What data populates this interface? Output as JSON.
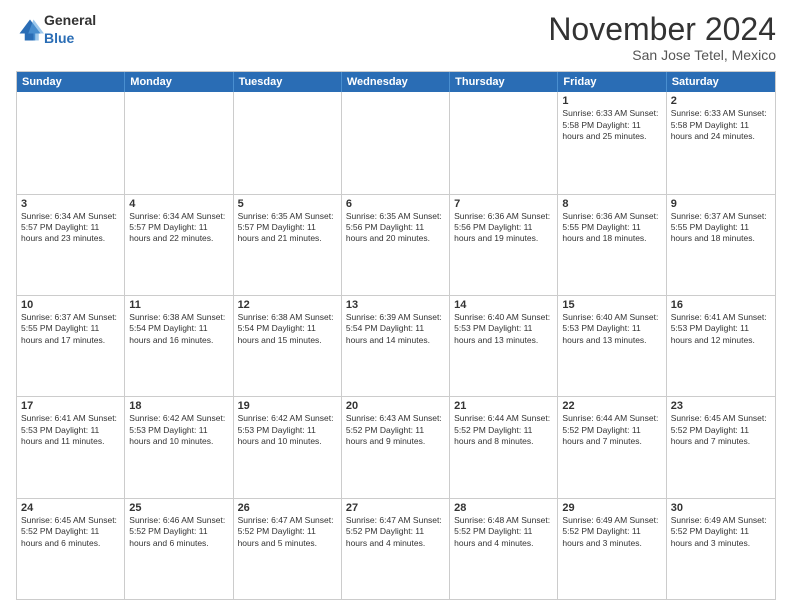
{
  "logo": {
    "general": "General",
    "blue": "Blue"
  },
  "header": {
    "title": "November 2024",
    "location": "San Jose Tetel, Mexico"
  },
  "weekdays": [
    "Sunday",
    "Monday",
    "Tuesday",
    "Wednesday",
    "Thursday",
    "Friday",
    "Saturday"
  ],
  "weeks": [
    [
      {
        "day": "",
        "info": ""
      },
      {
        "day": "",
        "info": ""
      },
      {
        "day": "",
        "info": ""
      },
      {
        "day": "",
        "info": ""
      },
      {
        "day": "",
        "info": ""
      },
      {
        "day": "1",
        "info": "Sunrise: 6:33 AM\nSunset: 5:58 PM\nDaylight: 11 hours and 25 minutes."
      },
      {
        "day": "2",
        "info": "Sunrise: 6:33 AM\nSunset: 5:58 PM\nDaylight: 11 hours and 24 minutes."
      }
    ],
    [
      {
        "day": "3",
        "info": "Sunrise: 6:34 AM\nSunset: 5:57 PM\nDaylight: 11 hours and 23 minutes."
      },
      {
        "day": "4",
        "info": "Sunrise: 6:34 AM\nSunset: 5:57 PM\nDaylight: 11 hours and 22 minutes."
      },
      {
        "day": "5",
        "info": "Sunrise: 6:35 AM\nSunset: 5:57 PM\nDaylight: 11 hours and 21 minutes."
      },
      {
        "day": "6",
        "info": "Sunrise: 6:35 AM\nSunset: 5:56 PM\nDaylight: 11 hours and 20 minutes."
      },
      {
        "day": "7",
        "info": "Sunrise: 6:36 AM\nSunset: 5:56 PM\nDaylight: 11 hours and 19 minutes."
      },
      {
        "day": "8",
        "info": "Sunrise: 6:36 AM\nSunset: 5:55 PM\nDaylight: 11 hours and 18 minutes."
      },
      {
        "day": "9",
        "info": "Sunrise: 6:37 AM\nSunset: 5:55 PM\nDaylight: 11 hours and 18 minutes."
      }
    ],
    [
      {
        "day": "10",
        "info": "Sunrise: 6:37 AM\nSunset: 5:55 PM\nDaylight: 11 hours and 17 minutes."
      },
      {
        "day": "11",
        "info": "Sunrise: 6:38 AM\nSunset: 5:54 PM\nDaylight: 11 hours and 16 minutes."
      },
      {
        "day": "12",
        "info": "Sunrise: 6:38 AM\nSunset: 5:54 PM\nDaylight: 11 hours and 15 minutes."
      },
      {
        "day": "13",
        "info": "Sunrise: 6:39 AM\nSunset: 5:54 PM\nDaylight: 11 hours and 14 minutes."
      },
      {
        "day": "14",
        "info": "Sunrise: 6:40 AM\nSunset: 5:53 PM\nDaylight: 11 hours and 13 minutes."
      },
      {
        "day": "15",
        "info": "Sunrise: 6:40 AM\nSunset: 5:53 PM\nDaylight: 11 hours and 13 minutes."
      },
      {
        "day": "16",
        "info": "Sunrise: 6:41 AM\nSunset: 5:53 PM\nDaylight: 11 hours and 12 minutes."
      }
    ],
    [
      {
        "day": "17",
        "info": "Sunrise: 6:41 AM\nSunset: 5:53 PM\nDaylight: 11 hours and 11 minutes."
      },
      {
        "day": "18",
        "info": "Sunrise: 6:42 AM\nSunset: 5:53 PM\nDaylight: 11 hours and 10 minutes."
      },
      {
        "day": "19",
        "info": "Sunrise: 6:42 AM\nSunset: 5:53 PM\nDaylight: 11 hours and 10 minutes."
      },
      {
        "day": "20",
        "info": "Sunrise: 6:43 AM\nSunset: 5:52 PM\nDaylight: 11 hours and 9 minutes."
      },
      {
        "day": "21",
        "info": "Sunrise: 6:44 AM\nSunset: 5:52 PM\nDaylight: 11 hours and 8 minutes."
      },
      {
        "day": "22",
        "info": "Sunrise: 6:44 AM\nSunset: 5:52 PM\nDaylight: 11 hours and 7 minutes."
      },
      {
        "day": "23",
        "info": "Sunrise: 6:45 AM\nSunset: 5:52 PM\nDaylight: 11 hours and 7 minutes."
      }
    ],
    [
      {
        "day": "24",
        "info": "Sunrise: 6:45 AM\nSunset: 5:52 PM\nDaylight: 11 hours and 6 minutes."
      },
      {
        "day": "25",
        "info": "Sunrise: 6:46 AM\nSunset: 5:52 PM\nDaylight: 11 hours and 6 minutes."
      },
      {
        "day": "26",
        "info": "Sunrise: 6:47 AM\nSunset: 5:52 PM\nDaylight: 11 hours and 5 minutes."
      },
      {
        "day": "27",
        "info": "Sunrise: 6:47 AM\nSunset: 5:52 PM\nDaylight: 11 hours and 4 minutes."
      },
      {
        "day": "28",
        "info": "Sunrise: 6:48 AM\nSunset: 5:52 PM\nDaylight: 11 hours and 4 minutes."
      },
      {
        "day": "29",
        "info": "Sunrise: 6:49 AM\nSunset: 5:52 PM\nDaylight: 11 hours and 3 minutes."
      },
      {
        "day": "30",
        "info": "Sunrise: 6:49 AM\nSunset: 5:52 PM\nDaylight: 11 hours and 3 minutes."
      }
    ]
  ]
}
